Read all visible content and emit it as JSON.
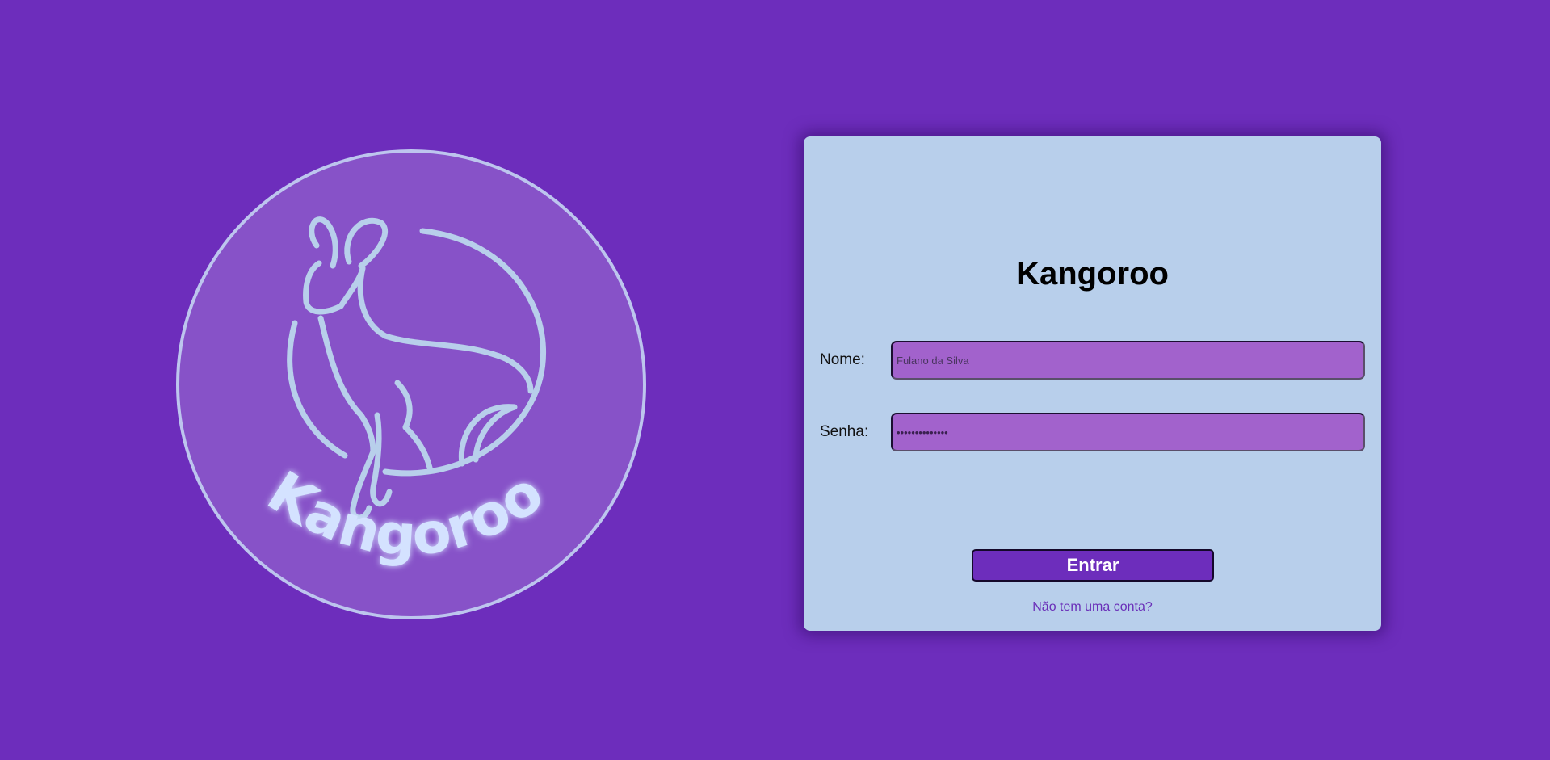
{
  "brand": {
    "logo_text": "Kangoroo"
  },
  "login": {
    "title": "Kangoroo",
    "name_label": "Nome:",
    "name_placeholder": "Fulano da Silva",
    "password_label": "Senha:",
    "password_value": "••••••••••••••",
    "submit_label": "Entrar",
    "signup_link": "Não tem uma conta?"
  },
  "colors": {
    "background": "#6d2dbc",
    "card": "#b8cfeb",
    "input": "#a262cc",
    "logo_line": "#b8cfeb",
    "logo_fill": "#8853c9"
  },
  "icons": {
    "logo": "kangaroo-icon"
  }
}
